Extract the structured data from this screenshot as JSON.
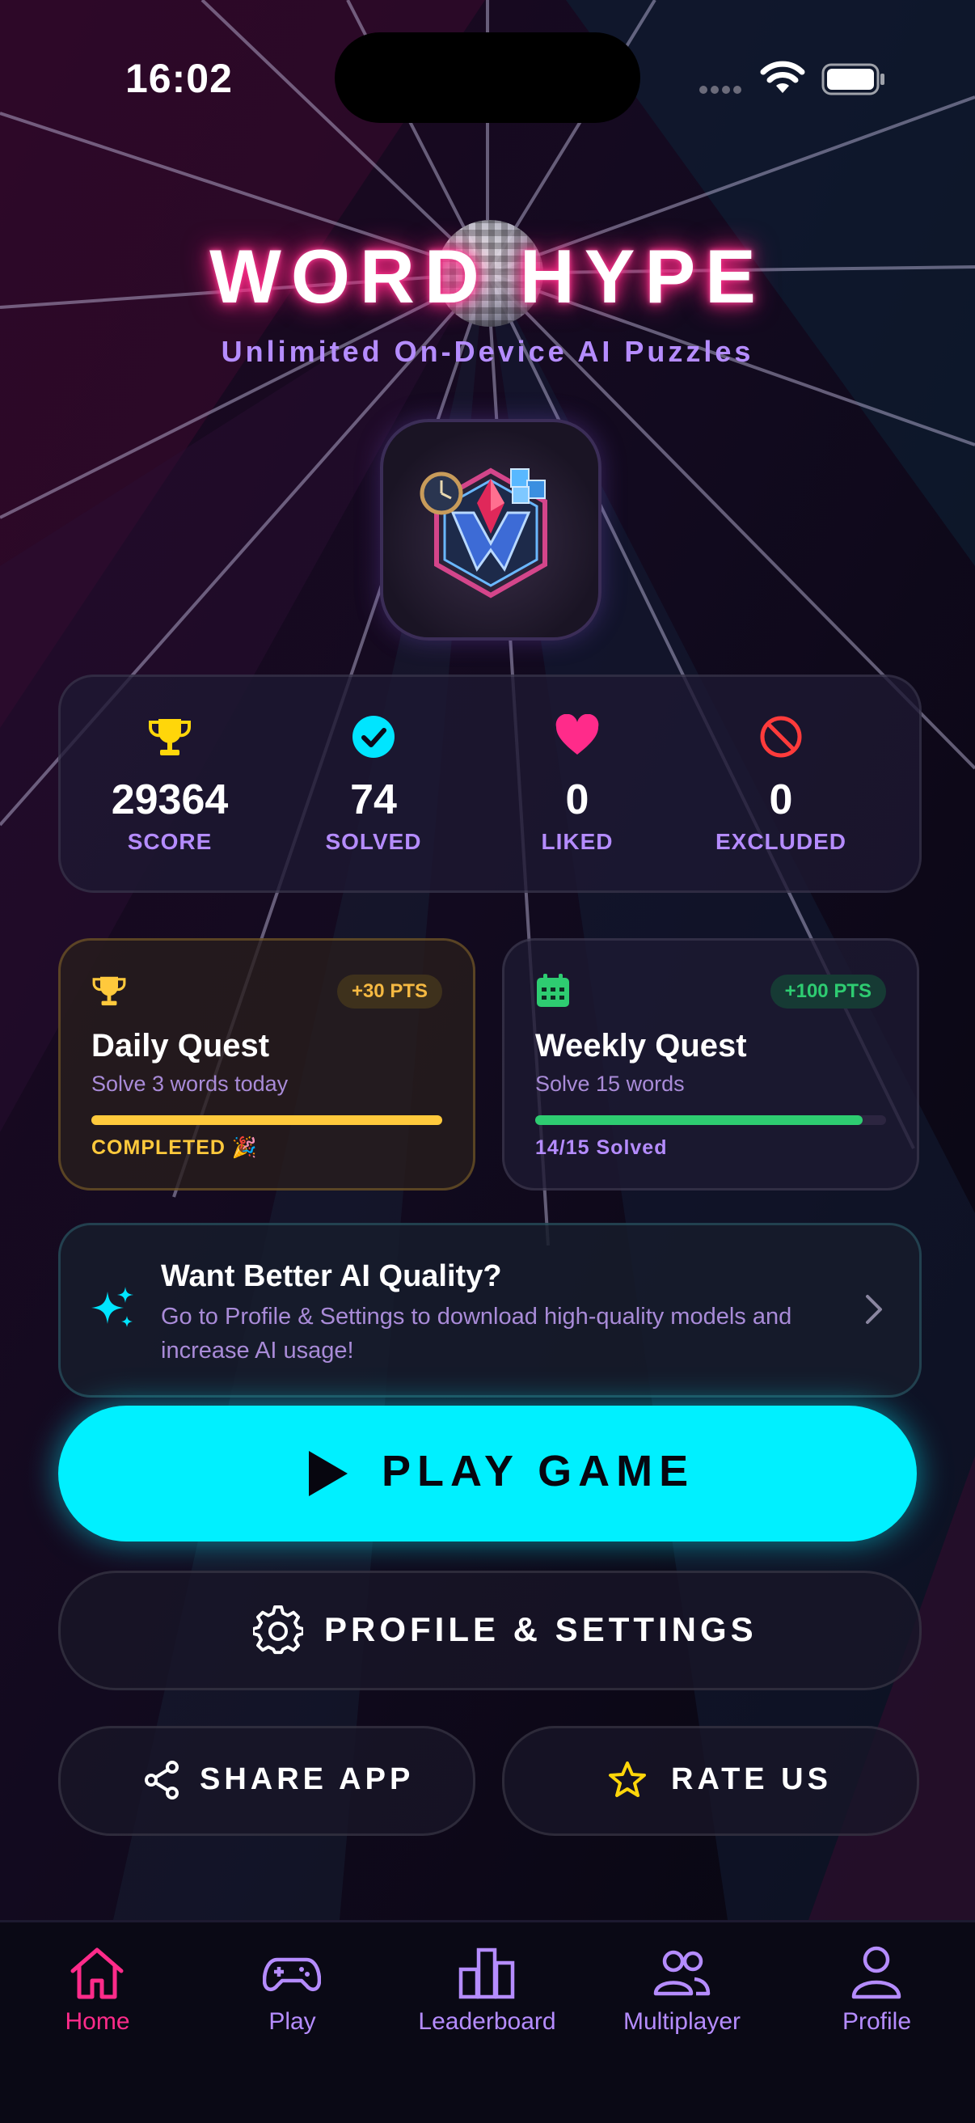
{
  "status_bar": {
    "time": "16:02"
  },
  "header": {
    "title": "WORD HYPE",
    "subtitle": "Unlimited On-Device AI Puzzles"
  },
  "stats": [
    {
      "value": "29364",
      "label": "SCORE",
      "icon": "trophy-icon",
      "color": "#ffd60a"
    },
    {
      "value": "74",
      "label": "SOLVED",
      "icon": "check-circle-icon",
      "color": "#00e5ff"
    },
    {
      "value": "0",
      "label": "LIKED",
      "icon": "heart-icon",
      "color": "#ff2b8a"
    },
    {
      "value": "0",
      "label": "EXCLUDED",
      "icon": "block-icon",
      "color": "#ff3b3b"
    }
  ],
  "quests": {
    "daily": {
      "title": "Daily Quest",
      "subtitle": "Solve 3 words today",
      "points": "+30 PTS",
      "status": "COMPLETED 🎉",
      "progress": 1.0,
      "color": "#ffc93c"
    },
    "weekly": {
      "title": "Weekly Quest",
      "subtitle": "Solve 15 words",
      "points": "+100 PTS",
      "status": "14/15 Solved",
      "progress": 0.933,
      "color": "#2ecc71"
    }
  },
  "banner": {
    "title": "Want Better AI Quality?",
    "text": "Go to Profile & Settings to download high-quality models and increase AI usage!"
  },
  "buttons": {
    "play": "PLAY GAME",
    "settings": "PROFILE & SETTINGS",
    "share": "SHARE APP",
    "rate": "RATE US"
  },
  "tabs": [
    {
      "label": "Home",
      "icon": "home-icon",
      "active": true
    },
    {
      "label": "Play",
      "icon": "gamepad-icon",
      "active": false
    },
    {
      "label": "Leaderboard",
      "icon": "leaderboard-icon",
      "active": false
    },
    {
      "label": "Multiplayer",
      "icon": "users-icon",
      "active": false
    },
    {
      "label": "Profile",
      "icon": "user-icon",
      "active": false
    }
  ],
  "colors": {
    "accent_cyan": "#00f0ff",
    "accent_pink": "#ff2b8a",
    "accent_purple": "#b58cff",
    "background": "#0b0a1a"
  }
}
